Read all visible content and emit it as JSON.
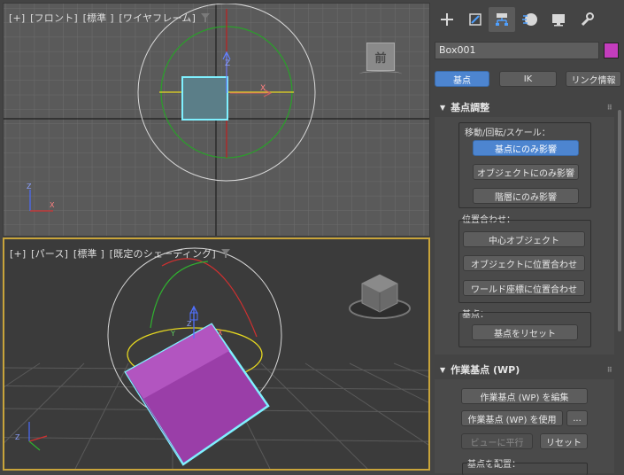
{
  "viewports": {
    "front": {
      "labels": [
        "[+]",
        "[フロント]",
        "[標準 ]",
        "[ワイヤフレーム]"
      ],
      "viewcube_label": "前"
    },
    "perspective": {
      "labels": [
        "[+]",
        "[パース]",
        "[標準 ]",
        "[既定のシェーディング]"
      ]
    }
  },
  "panel": {
    "tabs": [
      "create",
      "modify",
      "hierarchy",
      "motion",
      "display",
      "utilities"
    ],
    "object_name": "Box001",
    "object_color": "#c33dbd",
    "subtabs": {
      "pivot": "基点",
      "ik": "IK",
      "link": "リンク情報"
    },
    "adjust_pivot": {
      "title": "基点調整",
      "move_rotate_scale": "移動/回転/スケール：",
      "affect_pivot_only": "基点にのみ影響",
      "affect_object_only": "オブジェクトにのみ影響",
      "affect_hierarchy_only": "階層にのみ影響",
      "alignment": "位置合わせ：",
      "center_to_object": "中心オブジェクト",
      "align_to_object": "オブジェクトに位置合わせ",
      "align_to_world": "ワールド座標に位置合わせ",
      "pivot": "基点：",
      "reset_pivot": "基点をリセット"
    },
    "working_pivot": {
      "title": "作業基点 (WP)",
      "edit_wp": "作業基点 (WP) を編集",
      "use_wp": "作業基点 (WP) を使用",
      "more": "...",
      "align_to_view": "ビューに平行",
      "reset": "リセット",
      "place_pivot": "基点を配置："
    }
  }
}
